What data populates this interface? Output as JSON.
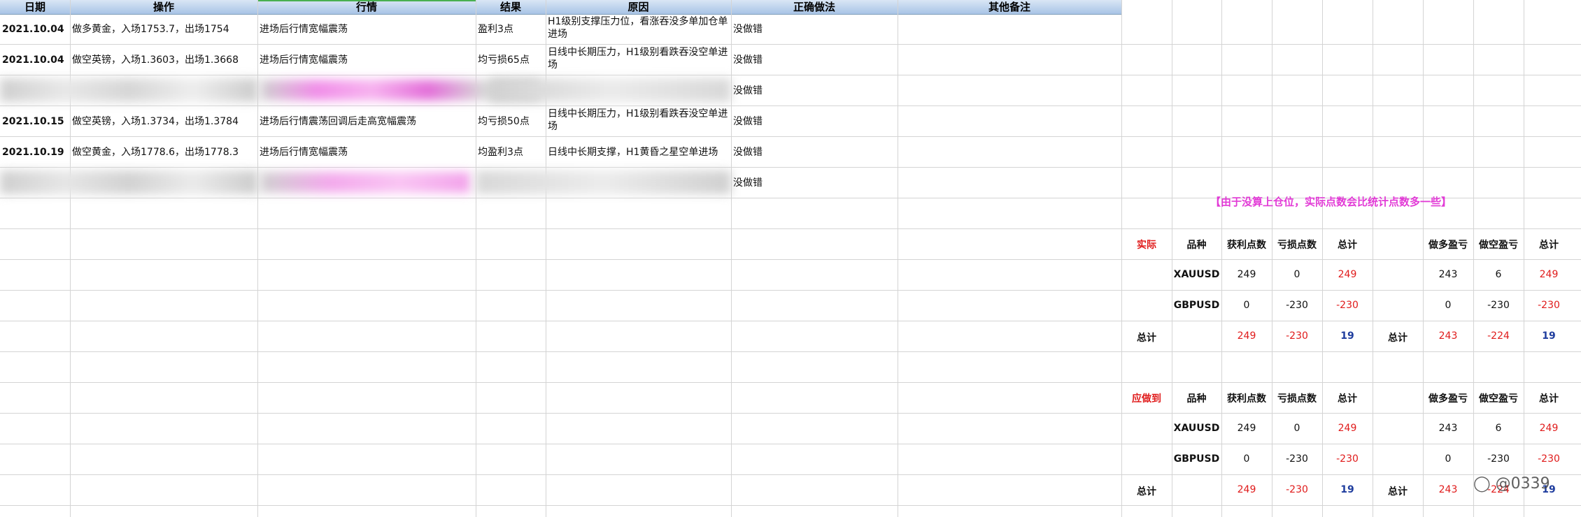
{
  "columns": [
    "日期",
    "操作",
    "行情",
    "结果",
    "原因",
    "正确做法",
    "其他备注"
  ],
  "rows": [
    {
      "date": "2021.10.04",
      "op": "做多黄金，入场1753.7，出场1754",
      "market": "进场后行情宽幅震荡",
      "result": "盈利3点",
      "reason": "H1级别支撑压力位，看涨吞没多单加仓单进场",
      "correct": "没做错"
    },
    {
      "date": "2021.10.04",
      "op": "做空英镑，入场1.3603，出场1.3668",
      "market": "进场后行情宽幅震荡",
      "result": "均亏损65点",
      "reason": "日线中长期压力，H1级别看跌吞没空单进场",
      "correct": "没做错"
    },
    {
      "date": "",
      "op": "",
      "market": "",
      "result": "",
      "reason": "日线中长期压力，H1级别看跌吞没空单进场",
      "correct": "没做错"
    },
    {
      "date": "2021.10.15",
      "op": "做空英镑，入场1.3734，出场1.3784",
      "market": "进场后行情震荡回调后走高宽幅震荡",
      "result": "均亏损50点",
      "reason": "日线中长期压力，H1级别看跌吞没空单进场",
      "correct": "没做错"
    },
    {
      "date": "2021.10.19",
      "op": "做空黄金，入场1778.6，出场1778.3",
      "market": "进场后行情宽幅震荡",
      "result": "均盈利3点",
      "reason": "日线中长期支撑，H1黄昏之星空单进场",
      "correct": "没做错"
    },
    {
      "date": "",
      "op": "",
      "market": "",
      "result": "",
      "reason": "",
      "correct": "没做错"
    }
  ],
  "note": "【由于没算上仓位，实际点数会比统计点数多一些】",
  "summary": [
    {
      "label": "实际",
      "headers": [
        "品种",
        "获利点数",
        "亏损点数",
        "总计",
        "做多盈亏",
        "做空盈亏",
        "总计"
      ],
      "items": [
        {
          "symbol": "XAUUSD",
          "profit": "249",
          "loss": "0",
          "total": "249",
          "long": "243",
          "short": "6",
          "total2": "249"
        },
        {
          "symbol": "GBPUSD",
          "profit": "0",
          "loss": "-230",
          "total": "-230",
          "long": "0",
          "short": "-230",
          "total2": "-230"
        }
      ],
      "totals": {
        "label": "总计",
        "profit": "249",
        "loss": "-230",
        "total": "19",
        "label2": "总计",
        "long": "243",
        "short": "-224",
        "total2": "19"
      }
    },
    {
      "label": "应做到",
      "headers": [
        "品种",
        "获利点数",
        "亏损点数",
        "总计",
        "做多盈亏",
        "做空盈亏",
        "总计"
      ],
      "items": [
        {
          "symbol": "XAUUSD",
          "profit": "249",
          "loss": "0",
          "total": "249",
          "long": "243",
          "short": "6",
          "total2": "249"
        },
        {
          "symbol": "GBPUSD",
          "profit": "0",
          "loss": "-230",
          "total": "-230",
          "long": "0",
          "short": "-230",
          "total2": "-230"
        }
      ],
      "totals": {
        "label": "总计",
        "profit": "249",
        "loss": "-230",
        "total": "19",
        "label2": "总计",
        "long": "243",
        "short": "-224",
        "total2": "19"
      }
    }
  ],
  "watermark": "@0339",
  "colors": {
    "note": "#e23ad6",
    "negative": "#e01b1b",
    "total": "#1f3d9e",
    "label": "#e01b1b"
  }
}
